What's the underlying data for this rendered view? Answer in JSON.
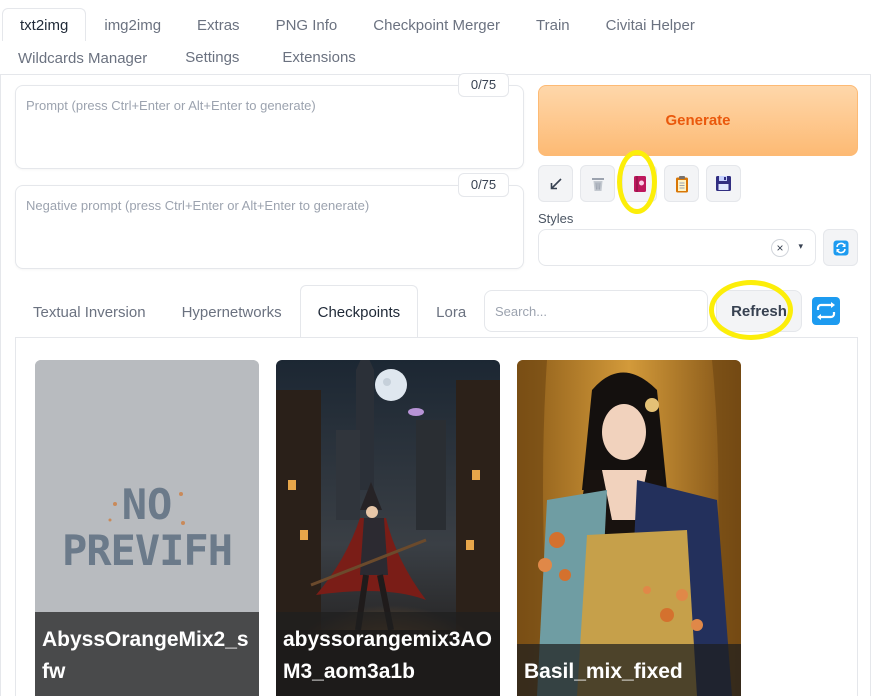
{
  "top_tabs": [
    "txt2img",
    "img2img",
    "Extras",
    "PNG Info",
    "Checkpoint Merger",
    "Train",
    "Civitai Helper",
    "Wildcards Manager",
    "Settings",
    "Extensions"
  ],
  "prompt": {
    "placeholder": "Prompt (press Ctrl+Enter or Alt+Enter to generate)",
    "token_count": "0/75"
  },
  "negative_prompt": {
    "placeholder": "Negative prompt (press Ctrl+Enter or Alt+Enter to generate)",
    "token_count": "0/75"
  },
  "generate_label": "Generate",
  "tool_buttons": [
    "read-params-icon",
    "trash-icon",
    "show-extra-networks-icon",
    "paste-style-icon",
    "save-style-icon"
  ],
  "styles": {
    "label": "Styles",
    "clear_glyph": "×",
    "caret_glyph": "▾"
  },
  "extra_tabs": [
    "Textual Inversion",
    "Hypernetworks",
    "Checkpoints",
    "Lora"
  ],
  "search_placeholder": "Search...",
  "refresh_label": "Refresh",
  "no_preview": {
    "line1": "NO",
    "line2": "PREVIFH"
  },
  "cards": [
    "AbyssOrangeMix2_sfw",
    "abyssorangemix3AOM3_aom3a1b",
    "Basil_mix_fixed"
  ],
  "colors": {
    "accent_orange": "#ea580c",
    "highlight_yellow": "#fcee09",
    "icon_blue": "#1d9bf0"
  }
}
